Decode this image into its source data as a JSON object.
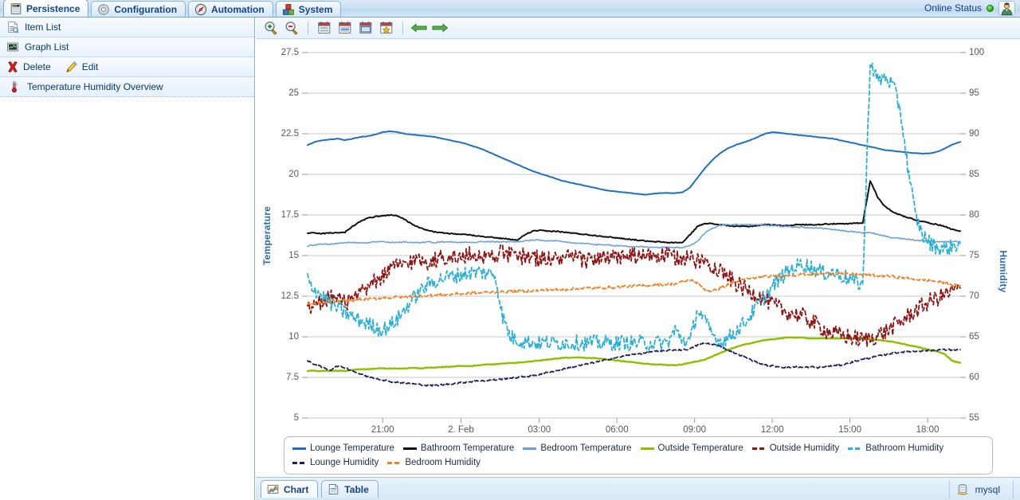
{
  "topbar": {
    "tabs": [
      {
        "label": "Persistence",
        "icon": "database-server-icon",
        "active": true
      },
      {
        "label": "Configuration",
        "icon": "gear-icon",
        "active": false
      },
      {
        "label": "Automation",
        "icon": "compass-icon",
        "active": false
      },
      {
        "label": "System",
        "icon": "blocks-icon",
        "active": false
      }
    ],
    "status_label": "Online Status",
    "status_color": "#1faa1f",
    "user_icon": "user-avatar-icon"
  },
  "sidebar": {
    "items": [
      {
        "label": "Item List",
        "icon": "item-list-icon"
      },
      {
        "label": "Graph List",
        "icon": "graph-list-icon"
      }
    ],
    "actions": [
      {
        "label": "Delete",
        "icon": "delete-icon"
      },
      {
        "label": "Edit",
        "icon": "edit-pencil-icon"
      }
    ],
    "tree": [
      {
        "label": "Temperature Humidity Overview",
        "icon": "thermometer-icon"
      }
    ]
  },
  "chart_toolbar": {
    "buttons": [
      {
        "name": "zoom-in-icon",
        "title": "Zoom In"
      },
      {
        "name": "zoom-out-icon",
        "title": "Zoom Out"
      },
      {
        "name": "calendar-day-icon",
        "title": "Day"
      },
      {
        "name": "calendar-week-icon",
        "title": "Week"
      },
      {
        "name": "calendar-month-icon",
        "title": "Month"
      },
      {
        "name": "calendar-favourite-icon",
        "title": "Favourite"
      },
      {
        "name": "arrow-left-icon",
        "title": "Previous"
      },
      {
        "name": "arrow-right-icon",
        "title": "Next"
      }
    ]
  },
  "bottom": {
    "tabs": [
      {
        "label": "Chart",
        "icon": "chart-icon",
        "active": true
      },
      {
        "label": "Table",
        "icon": "table-icon",
        "active": false
      }
    ],
    "database": {
      "label": "mysql",
      "icon": "database-icon"
    }
  },
  "chart_data": {
    "type": "line",
    "title": "",
    "xlabel": "",
    "ylabel": "Temperature",
    "y2label": "Humidity",
    "grid": true,
    "legend_position": "bottom",
    "x_ticks": [
      "21:00",
      "2. Feb",
      "03:00",
      "06:00",
      "09:00",
      "12:00",
      "15:00",
      "18:00"
    ],
    "x_tick_positions": [
      0.115,
      0.235,
      0.355,
      0.474,
      0.593,
      0.712,
      0.831,
      0.95
    ],
    "y_ticks": [
      5,
      7.5,
      10,
      12.5,
      15,
      17.5,
      20,
      22.5,
      25,
      27.5
    ],
    "ylim": [
      5,
      27.5
    ],
    "y2_ticks": [
      55,
      60,
      65,
      70,
      75,
      80,
      85,
      90,
      95,
      100
    ],
    "y2lim": [
      55,
      100
    ],
    "series": [
      {
        "name": "Lounge Temperature",
        "color": "#1f6fc4",
        "axis": "left",
        "style": "solid",
        "width": 2,
        "values": [
          21.8,
          22.0,
          22.1,
          22.15,
          22.2,
          22.1,
          22.2,
          22.3,
          22.35,
          22.45,
          22.6,
          22.65,
          22.6,
          22.5,
          22.45,
          22.4,
          22.35,
          22.3,
          22.2,
          22.1,
          22.0,
          21.9,
          21.75,
          21.6,
          21.4,
          21.2,
          21.0,
          20.8,
          20.6,
          20.4,
          20.2,
          20.05,
          19.9,
          19.75,
          19.6,
          19.5,
          19.4,
          19.3,
          19.2,
          19.1,
          19.0,
          18.95,
          18.9,
          18.85,
          18.8,
          18.75,
          18.8,
          18.85,
          18.85,
          18.85,
          18.9,
          19.2,
          19.8,
          20.4,
          20.9,
          21.3,
          21.6,
          21.8,
          21.95,
          22.1,
          22.3,
          22.5,
          22.6,
          22.55,
          22.5,
          22.45,
          22.4,
          22.35,
          22.3,
          22.25,
          22.2,
          22.1,
          22.0,
          21.9,
          21.8,
          21.7,
          21.6,
          21.5,
          21.45,
          21.4,
          21.35,
          21.3,
          21.28,
          21.3,
          21.4,
          21.6,
          21.85,
          22.0
        ]
      },
      {
        "name": "Bathroom Temperature",
        "color": "#111111",
        "axis": "left",
        "style": "solid",
        "width": 2,
        "values": [
          16.4,
          16.4,
          16.35,
          16.4,
          16.4,
          16.45,
          16.8,
          17.1,
          17.3,
          17.4,
          17.45,
          17.5,
          17.45,
          17.2,
          16.9,
          16.7,
          16.55,
          16.45,
          16.4,
          16.35,
          16.3,
          16.3,
          16.25,
          16.2,
          16.15,
          16.1,
          16.05,
          16.0,
          15.95,
          16.3,
          16.5,
          16.55,
          16.5,
          16.5,
          16.45,
          16.4,
          16.35,
          16.3,
          16.25,
          16.2,
          16.15,
          16.1,
          16.05,
          16.0,
          15.95,
          15.9,
          15.85,
          15.85,
          15.8,
          15.8,
          15.8,
          16.3,
          16.8,
          17.0,
          16.95,
          16.9,
          16.85,
          16.8,
          16.8,
          16.8,
          16.85,
          16.9,
          16.9,
          16.85,
          16.85,
          16.9,
          16.9,
          16.9,
          16.9,
          16.95,
          16.95,
          16.95,
          16.95,
          17.0,
          17.0,
          19.6,
          18.6,
          18.0,
          17.7,
          17.5,
          17.35,
          17.2,
          17.1,
          17.0,
          16.9,
          16.8,
          16.6,
          16.5
        ]
      },
      {
        "name": "Bedroom Temperature",
        "color": "#6ba2dd",
        "axis": "left",
        "style": "solid",
        "width": 1.6,
        "values": [
          15.6,
          15.65,
          15.7,
          15.7,
          15.75,
          15.8,
          15.8,
          15.8,
          15.8,
          15.85,
          15.85,
          15.8,
          15.8,
          15.85,
          15.8,
          15.8,
          15.85,
          15.8,
          15.85,
          15.85,
          15.8,
          15.85,
          15.8,
          15.85,
          15.85,
          15.85,
          15.85,
          15.85,
          15.85,
          15.9,
          15.95,
          15.95,
          15.9,
          15.9,
          15.85,
          15.8,
          15.75,
          15.75,
          15.7,
          15.65,
          15.65,
          15.6,
          15.6,
          15.55,
          15.55,
          15.55,
          15.5,
          15.5,
          15.5,
          15.5,
          15.5,
          15.6,
          15.9,
          16.4,
          16.7,
          16.85,
          16.9,
          16.9,
          16.9,
          16.9,
          16.9,
          16.85,
          16.85,
          16.8,
          16.8,
          16.75,
          16.75,
          16.7,
          16.7,
          16.65,
          16.6,
          16.55,
          16.5,
          16.45,
          16.4,
          16.4,
          16.3,
          16.2,
          16.1,
          16.05,
          16.0,
          15.95,
          15.9,
          15.9,
          15.85,
          15.85,
          15.85,
          15.85
        ]
      },
      {
        "name": "Outside Temperature",
        "color": "#8cc000",
        "axis": "left",
        "style": "solid",
        "width": 2.4,
        "values": [
          7.9,
          7.9,
          7.9,
          7.9,
          7.9,
          7.9,
          7.95,
          8.0,
          8.0,
          8.05,
          8.05,
          8.05,
          8.05,
          8.05,
          8.1,
          8.05,
          8.1,
          8.1,
          8.15,
          8.15,
          8.2,
          8.2,
          8.2,
          8.25,
          8.3,
          8.3,
          8.35,
          8.4,
          8.4,
          8.45,
          8.5,
          8.55,
          8.6,
          8.65,
          8.7,
          8.7,
          8.75,
          8.7,
          8.7,
          8.65,
          8.6,
          8.55,
          8.5,
          8.45,
          8.4,
          8.35,
          8.3,
          8.3,
          8.25,
          8.25,
          8.3,
          8.4,
          8.5,
          8.6,
          8.8,
          9.0,
          9.2,
          9.35,
          9.5,
          9.6,
          9.7,
          9.8,
          9.85,
          9.9,
          9.95,
          9.95,
          9.95,
          9.9,
          9.9,
          9.9,
          9.9,
          9.9,
          9.9,
          9.9,
          9.9,
          9.85,
          9.8,
          9.75,
          9.7,
          9.6,
          9.5,
          9.4,
          9.3,
          9.2,
          9.1,
          8.9,
          8.5,
          8.4
        ]
      },
      {
        "name": "Outside Humidity",
        "color": "#8e1616",
        "axis": "right",
        "style": "dashed",
        "width": 1.8,
        "values": [
          68.5,
          68.8,
          69.5,
          70.0,
          69.6,
          69.2,
          69.5,
          70.2,
          71.0,
          71.8,
          72.5,
          73.2,
          73.8,
          74.0,
          74.3,
          74.6,
          74.2,
          74.5,
          74.8,
          75.0,
          74.6,
          74.9,
          75.2,
          75.0,
          74.8,
          75.2,
          75.4,
          75.0,
          74.8,
          75.0,
          74.8,
          74.6,
          74.7,
          74.5,
          74.6,
          74.8,
          74.6,
          74.4,
          74.6,
          74.8,
          74.5,
          74.7,
          74.9,
          75.0,
          74.8,
          74.9,
          75.1,
          74.9,
          75.0,
          74.7,
          74.8,
          74.6,
          74.4,
          74.2,
          73.8,
          73.2,
          72.4,
          71.6,
          71.0,
          70.5,
          70.2,
          69.6,
          69.0,
          68.4,
          68.0,
          67.8,
          67.5,
          67.0,
          66.4,
          65.8,
          65.4,
          65.2,
          65.0,
          64.8,
          64.6,
          64.8,
          65.2,
          65.6,
          66.2,
          66.8,
          67.5,
          68.2,
          68.8,
          69.4,
          69.8,
          70.2,
          70.6,
          71.0
        ]
      },
      {
        "name": "Bathroom Humidity",
        "color": "#2cb0d6",
        "axis": "right",
        "style": "dashed",
        "width": 1.8,
        "values": [
          72.0,
          70.8,
          70.0,
          69.2,
          68.5,
          68.0,
          67.4,
          67.0,
          66.6,
          66.2,
          65.8,
          66.4,
          67.2,
          68.4,
          69.6,
          70.6,
          71.4,
          71.9,
          72.2,
          72.4,
          72.6,
          72.8,
          72.9,
          73.0,
          72.8,
          72.6,
          67.5,
          65.0,
          64.6,
          64.4,
          64.3,
          64.2,
          64.3,
          64.2,
          64.3,
          64.2,
          64.3,
          64.2,
          64.3,
          64.2,
          64.3,
          64.2,
          64.3,
          64.2,
          64.3,
          64.2,
          64.3,
          64.2,
          64.3,
          65.8,
          64.6,
          64.4,
          68.5,
          66.8,
          65.2,
          64.4,
          64.8,
          65.6,
          66.5,
          67.6,
          68.8,
          70.0,
          71.2,
          72.2,
          73.0,
          73.6,
          74.0,
          73.6,
          73.2,
          72.8,
          73.0,
          72.6,
          72.2,
          71.8,
          71.4,
          99.0,
          96.5,
          97.0,
          96.0,
          93.0,
          86.0,
          80.0,
          77.5,
          76.5,
          76.0,
          75.8,
          76.2,
          76.5
        ]
      },
      {
        "name": "Lounge Humidity",
        "color": "#1d1f5c",
        "axis": "right",
        "style": "dashed",
        "width": 1.8,
        "values": [
          62.0,
          61.6,
          61.2,
          60.9,
          61.4,
          61.2,
          60.8,
          60.4,
          60.1,
          59.9,
          59.7,
          59.5,
          59.4,
          59.3,
          59.2,
          59.1,
          59.0,
          59.0,
          59.1,
          59.2,
          59.3,
          59.4,
          59.5,
          59.6,
          59.6,
          59.7,
          59.8,
          59.9,
          60.0,
          60.1,
          60.2,
          60.4,
          60.6,
          60.8,
          61.0,
          61.2,
          61.4,
          61.6,
          61.8,
          62.0,
          62.2,
          62.4,
          62.6,
          62.8,
          62.9,
          63.0,
          63.2,
          63.2,
          63.3,
          63.4,
          63.4,
          63.5,
          64.0,
          64.2,
          64.1,
          63.8,
          63.4,
          63.0,
          62.6,
          62.2,
          61.8,
          61.5,
          61.4,
          61.3,
          61.2,
          61.3,
          61.2,
          61.3,
          61.2,
          61.3,
          61.4,
          61.5,
          61.7,
          62.0,
          62.2,
          62.4,
          62.6,
          62.8,
          63.0,
          63.1,
          63.2,
          63.2,
          63.3,
          63.3,
          63.4,
          63.4,
          63.4,
          63.4
        ]
      },
      {
        "name": "Bedroom Humidity",
        "color": "#f08020",
        "axis": "right",
        "style": "dashed",
        "width": 1.8,
        "values": [
          69.0,
          69.1,
          69.2,
          69.3,
          69.4,
          69.4,
          69.5,
          69.6,
          69.6,
          69.7,
          69.8,
          69.8,
          69.9,
          69.9,
          70.0,
          70.0,
          70.1,
          70.1,
          70.2,
          70.2,
          70.3,
          70.3,
          70.4,
          70.4,
          70.5,
          70.5,
          70.5,
          70.6,
          70.6,
          70.6,
          70.7,
          70.7,
          70.8,
          70.8,
          70.8,
          70.9,
          70.9,
          71.0,
          71.0,
          71.0,
          71.1,
          71.1,
          71.2,
          71.2,
          71.3,
          71.3,
          71.4,
          71.4,
          71.5,
          71.5,
          71.8,
          72.0,
          71.6,
          70.8,
          70.6,
          71.0,
          71.4,
          71.8,
          72.0,
          72.2,
          72.3,
          72.4,
          72.5,
          72.5,
          72.6,
          72.6,
          72.7,
          72.7,
          72.7,
          72.8,
          72.8,
          72.8,
          72.7,
          72.7,
          72.6,
          72.6,
          72.5,
          72.5,
          72.4,
          72.3,
          72.2,
          72.1,
          72.0,
          71.9,
          71.8,
          71.6,
          71.4,
          71.3
        ]
      }
    ]
  }
}
